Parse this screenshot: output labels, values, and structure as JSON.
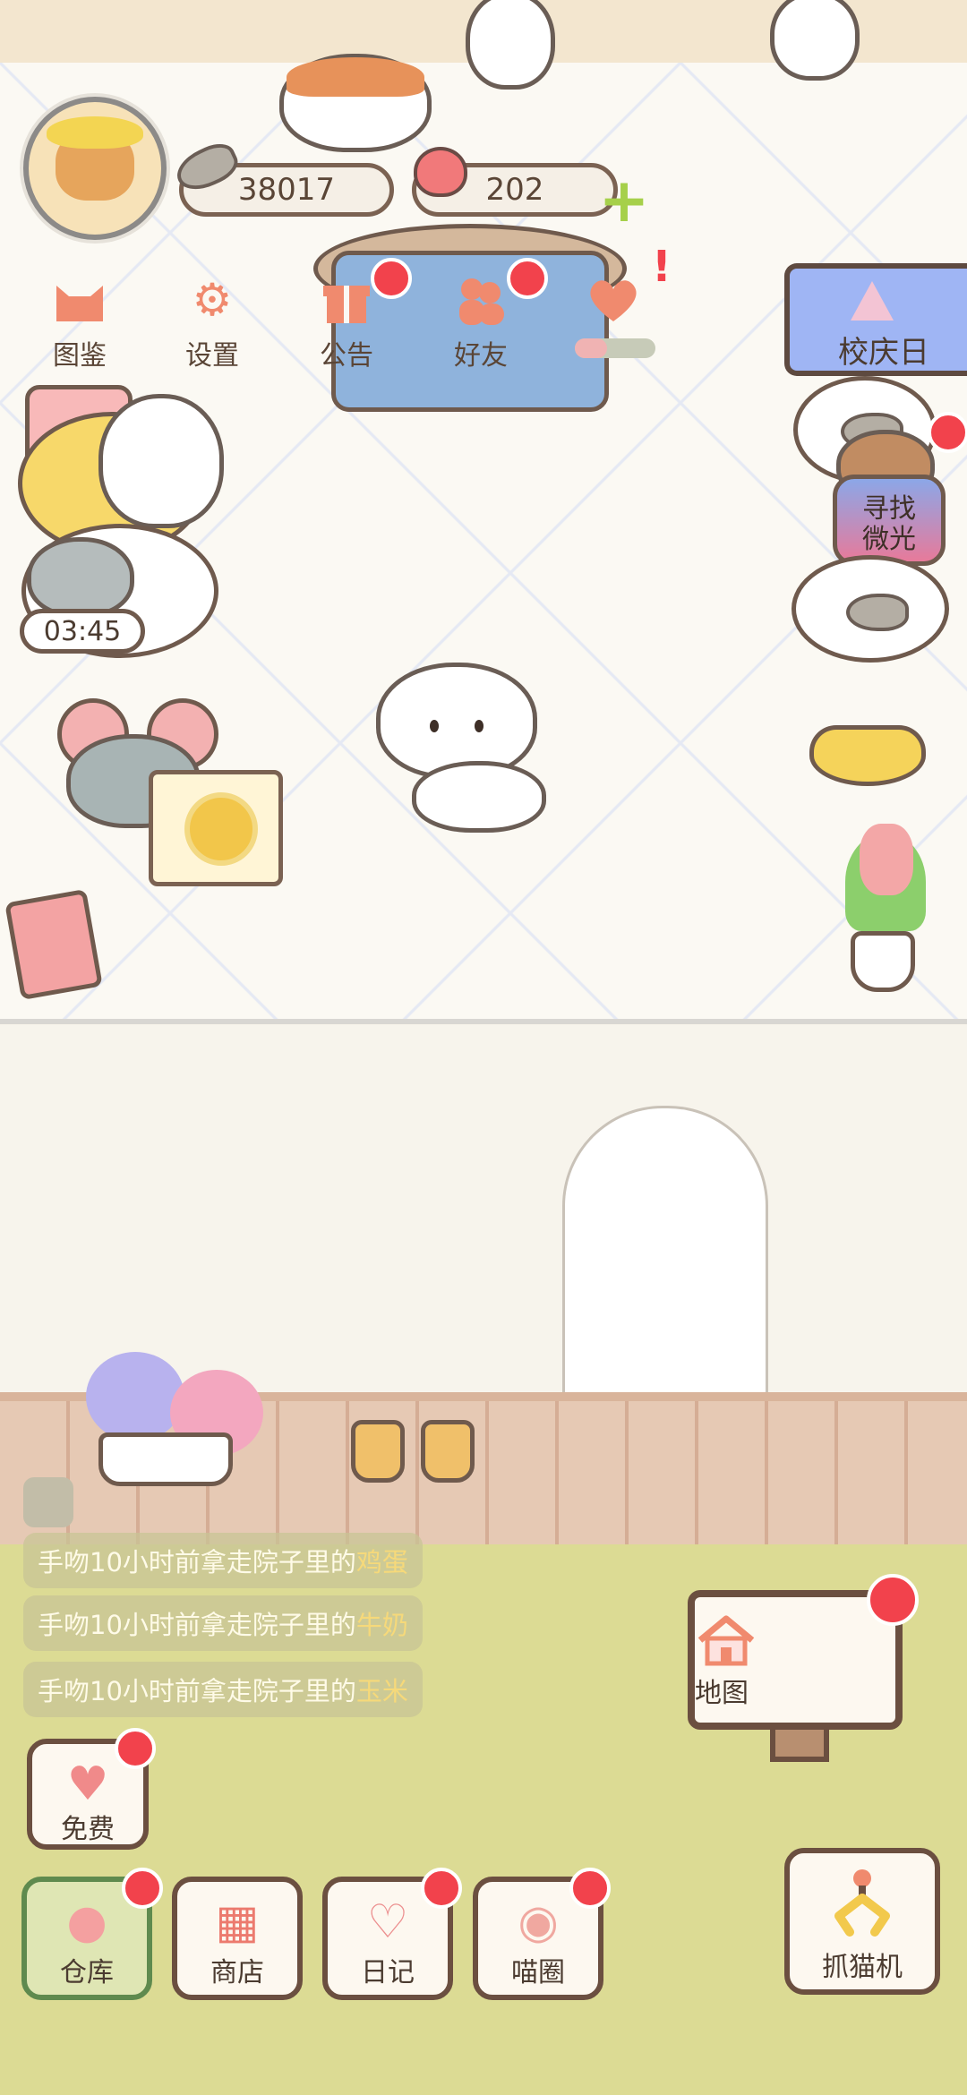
{
  "currency": {
    "fish_amount": "38017",
    "heart_amount": "202"
  },
  "top_menu": [
    {
      "label": "图鉴",
      "icon": "cat-head-icon"
    },
    {
      "label": "设置",
      "icon": "gear-icon"
    },
    {
      "label": "公告",
      "icon": "gift-icon"
    },
    {
      "label": "好友",
      "icon": "friends-icon"
    },
    {
      "label": "",
      "icon": "heart-wings-icon"
    }
  ],
  "event": {
    "label": "校庆日"
  },
  "quest": {
    "label_line1": "寻找",
    "label_line2": "微光"
  },
  "timer": "03:45",
  "feed": {
    "prefix": "手吻10小时前拿走院子里的",
    "items": [
      "鸡蛋",
      "牛奶",
      "玉米"
    ]
  },
  "bottom_buttons": {
    "free": "免费",
    "warehouse": "仓库",
    "shop": "商店",
    "diary": "日记",
    "meow_circle": "喵圈",
    "map": "地图",
    "claw_machine": "抓猫机"
  },
  "progress": {
    "fraction": 0.4
  },
  "colors": {
    "badge": "#f2424c",
    "accent": "#f08a6e",
    "outline": "#6b4f40",
    "grass": "#dcdb94"
  }
}
